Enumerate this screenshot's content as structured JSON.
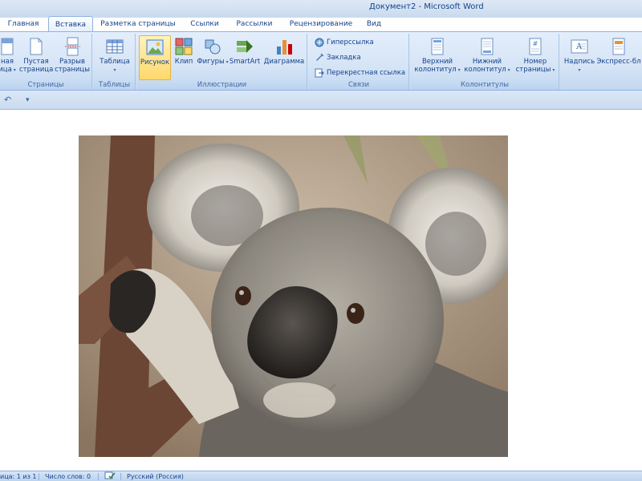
{
  "window": {
    "title": "Документ2 - Microsoft Word"
  },
  "tabs": [
    {
      "label": "Главная"
    },
    {
      "label": "Вставка"
    },
    {
      "label": "Разметка страницы"
    },
    {
      "label": "Ссылки"
    },
    {
      "label": "Рассылки"
    },
    {
      "label": "Рецензирование"
    },
    {
      "label": "Вид"
    }
  ],
  "ribbon": {
    "pages": {
      "label": "Страницы",
      "cover_line1": "ная",
      "cover_line2": "ица",
      "blank_line1": "Пустая",
      "blank_line2": "страница",
      "break_line1": "Разрыв",
      "break_line2": "страницы"
    },
    "tables": {
      "label": "Таблицы",
      "table": "Таблица"
    },
    "illustrations": {
      "label": "Иллюстрации",
      "picture": "Рисунок",
      "clip": "Клип",
      "shapes": "Фигуры",
      "smartart": "SmartArt",
      "chart": "Диаграмма"
    },
    "links": {
      "label": "Связи",
      "hyperlink": "Гиперссылка",
      "bookmark": "Закладка",
      "crossref": "Перекрестная ссылка"
    },
    "headers": {
      "label": "Колонтитулы",
      "header_line1": "Верхний",
      "header_line2": "колонтитул",
      "footer_line1": "Нижний",
      "footer_line2": "колонтитул",
      "pagenum_line1": "Номер",
      "pagenum_line2": "страницы"
    },
    "text": {
      "textbox": "Надпись",
      "quickparts": "Экспресс-бл"
    }
  },
  "qat": {
    "undo": "↶",
    "customize": "▾"
  },
  "status": {
    "page": "ица: 1 из 1",
    "words": "Число слов: 0",
    "language": "Русский (Россия)"
  },
  "colors": {
    "ribbon_accent": "#15428b",
    "selected_button": "#ffd86a"
  }
}
